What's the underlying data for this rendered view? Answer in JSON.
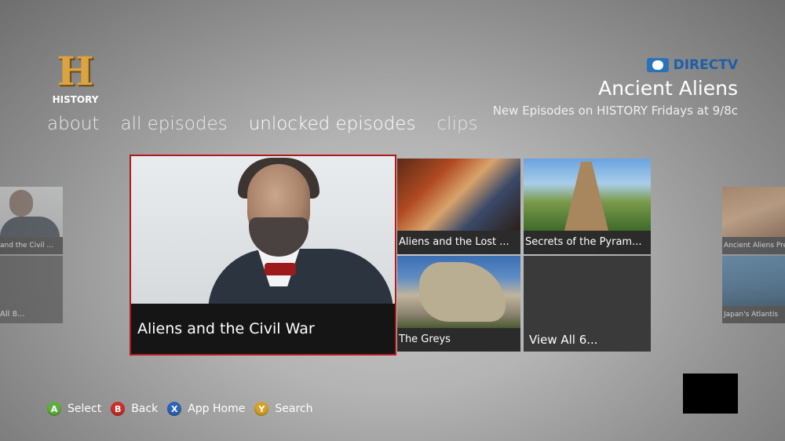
{
  "logo": {
    "letter": "H",
    "word": "HISTORY"
  },
  "nav": {
    "items": [
      {
        "label": "about",
        "active": false
      },
      {
        "label": "all episodes",
        "active": false
      },
      {
        "label": "unlocked episodes",
        "active": true
      },
      {
        "label": "clips",
        "active": false
      }
    ]
  },
  "header": {
    "provider": "DIRECTV",
    "show_title": "Ancient Aliens",
    "subtitle": "New Episodes on HISTORY Fridays at 9/8c"
  },
  "tiles": {
    "featured": {
      "caption": "Aliens and the Civil War",
      "selected": true
    },
    "grid": [
      {
        "caption": "Aliens and the Lost ..."
      },
      {
        "caption": "Secrets of the Pyram..."
      },
      {
        "caption": "The Greys"
      },
      {
        "caption": "View All 6..."
      }
    ],
    "left": [
      {
        "caption": "and the Civil ..."
      },
      {
        "caption": "All 8..."
      }
    ],
    "right": [
      {
        "caption": "Ancient Aliens Pre"
      },
      {
        "caption": "Japan's Atlantis"
      }
    ]
  },
  "controls": [
    {
      "button": "A",
      "label": "Select",
      "color": "#5fae3c"
    },
    {
      "button": "B",
      "label": "Back",
      "color": "#c7302b"
    },
    {
      "button": "X",
      "label": "App Home",
      "color": "#2d64b5"
    },
    {
      "button": "Y",
      "label": "Search",
      "color": "#d4a126"
    }
  ],
  "colors": {
    "selection_border": "#b01a1a",
    "provider_blue": "#1f5fa8"
  }
}
